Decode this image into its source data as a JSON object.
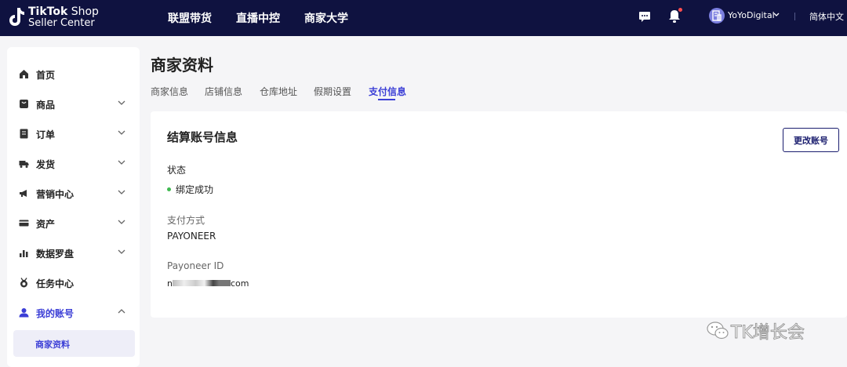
{
  "topbar": {
    "logo_line1_bold": "TikTok",
    "logo_line1_thin": " Shop",
    "logo_line2": "Seller Center",
    "nav": [
      "联盟带货",
      "直播中控",
      "商家大学"
    ],
    "username": "YoYoDigital",
    "language": "简体中文",
    "colors": {
      "background": "#0f1240",
      "notification_dot": "#ff4d4f"
    }
  },
  "sidebar": {
    "items": [
      {
        "label": "首页",
        "icon": "home-icon",
        "has_chevron": false
      },
      {
        "label": "商品",
        "icon": "product-icon",
        "has_chevron": true
      },
      {
        "label": "订单",
        "icon": "order-icon",
        "has_chevron": true
      },
      {
        "label": "发货",
        "icon": "truck-icon",
        "has_chevron": true
      },
      {
        "label": "营销中心",
        "icon": "megaphone-icon",
        "has_chevron": true
      },
      {
        "label": "资产",
        "icon": "card-icon",
        "has_chevron": true
      },
      {
        "label": "数据罗盘",
        "icon": "chart-icon",
        "has_chevron": true
      },
      {
        "label": "任务中心",
        "icon": "medal-icon",
        "has_chevron": false
      },
      {
        "label": "我的账号",
        "icon": "user-icon",
        "has_chevron": true,
        "expanded": true,
        "active": true
      }
    ],
    "subitem": "商家资料",
    "accent_color": "#3b3ed6"
  },
  "main": {
    "page_title": "商家资料",
    "tabs": [
      "商家信息",
      "店铺信息",
      "仓库地址",
      "假期设置",
      "支付信息"
    ],
    "active_tab": "支付信息",
    "card": {
      "title": "结算账号信息",
      "change_button": "更改账号",
      "status_label": "状态",
      "status_value": "绑定成功",
      "status_color": "#3fb950",
      "method_label": "支付方式",
      "method_value": "PAYONEER",
      "id_label": "Payoneer ID",
      "id_value_prefix": "n",
      "id_value_suffix": "com"
    }
  },
  "watermark": {
    "text": "TK增长会"
  }
}
